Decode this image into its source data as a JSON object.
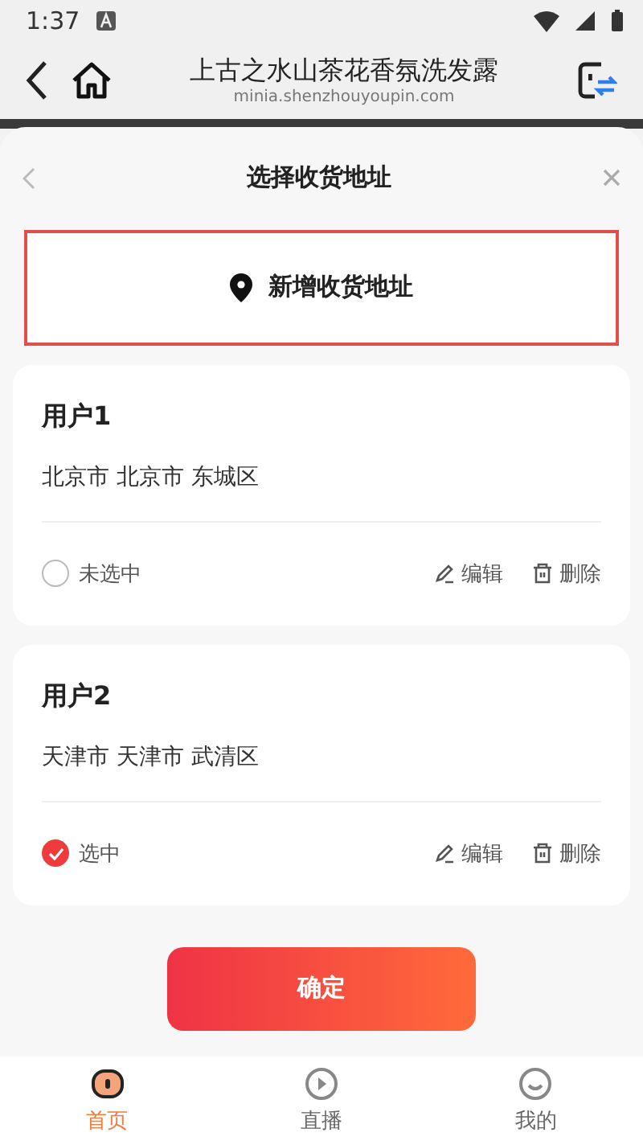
{
  "status_bar": {
    "time": "1:37"
  },
  "browser": {
    "title": "上古之水山茶花香氛洗发露",
    "url": "minia.shenzhouyoupin.com"
  },
  "sheet": {
    "title": "选择收货地址",
    "add_button": "新增收货地址",
    "addresses": [
      {
        "name": "用户1",
        "region": "北京市 北京市 东城区",
        "selected": false,
        "status": "未选中",
        "edit": "编辑",
        "delete": "删除"
      },
      {
        "name": "用户2",
        "region": "天津市 天津市 武清区",
        "selected": true,
        "status": "选中",
        "edit": "编辑",
        "delete": "删除"
      }
    ],
    "confirm": "确定"
  },
  "tab_bar": [
    {
      "label": "首页",
      "kind": "home",
      "selected": true
    },
    {
      "label": "直播",
      "kind": "live",
      "selected": false
    },
    {
      "label": "我的",
      "kind": "profile",
      "selected": false
    }
  ]
}
